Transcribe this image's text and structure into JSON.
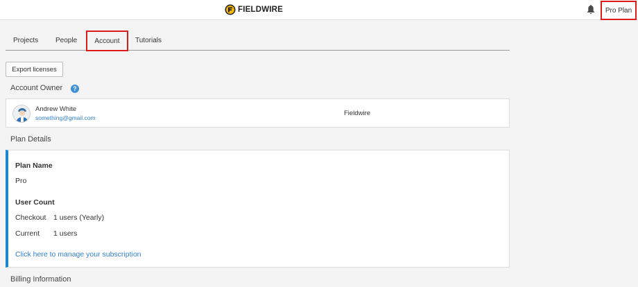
{
  "header": {
    "logo_text": "FIELDWIRE",
    "plan_button": "Pro Plan"
  },
  "tabs": [
    {
      "label": "Projects"
    },
    {
      "label": "People"
    },
    {
      "label": "Account"
    },
    {
      "label": "Tutorials"
    }
  ],
  "active_tab": "Account",
  "toolbar": {
    "export_label": "Export licenses"
  },
  "account_owner": {
    "heading": "Account Owner",
    "help_glyph": "?",
    "name": "Andrew White",
    "email": "something@gmail.com",
    "company": "Fieldwire"
  },
  "plan_details": {
    "heading": "Plan Details",
    "plan_name_label": "Plan Name",
    "plan_name_value": "Pro",
    "user_count_label": "User Count",
    "checkout_label": "Checkout",
    "checkout_value": "1 users (Yearly)",
    "current_label": "Current",
    "current_value": "1 users",
    "manage_link": "Click here to manage your subscription"
  },
  "billing": {
    "heading": "Billing Information"
  },
  "colors": {
    "accent": "#1b87d0",
    "link": "#2f7fd1",
    "logo_yellow": "#f5b800",
    "highlight": "#e01a1a"
  },
  "icons": {
    "logo": "fieldwire-logo-icon",
    "bell": "bell-icon",
    "help": "help-icon",
    "avatar": "avatar-icon"
  }
}
